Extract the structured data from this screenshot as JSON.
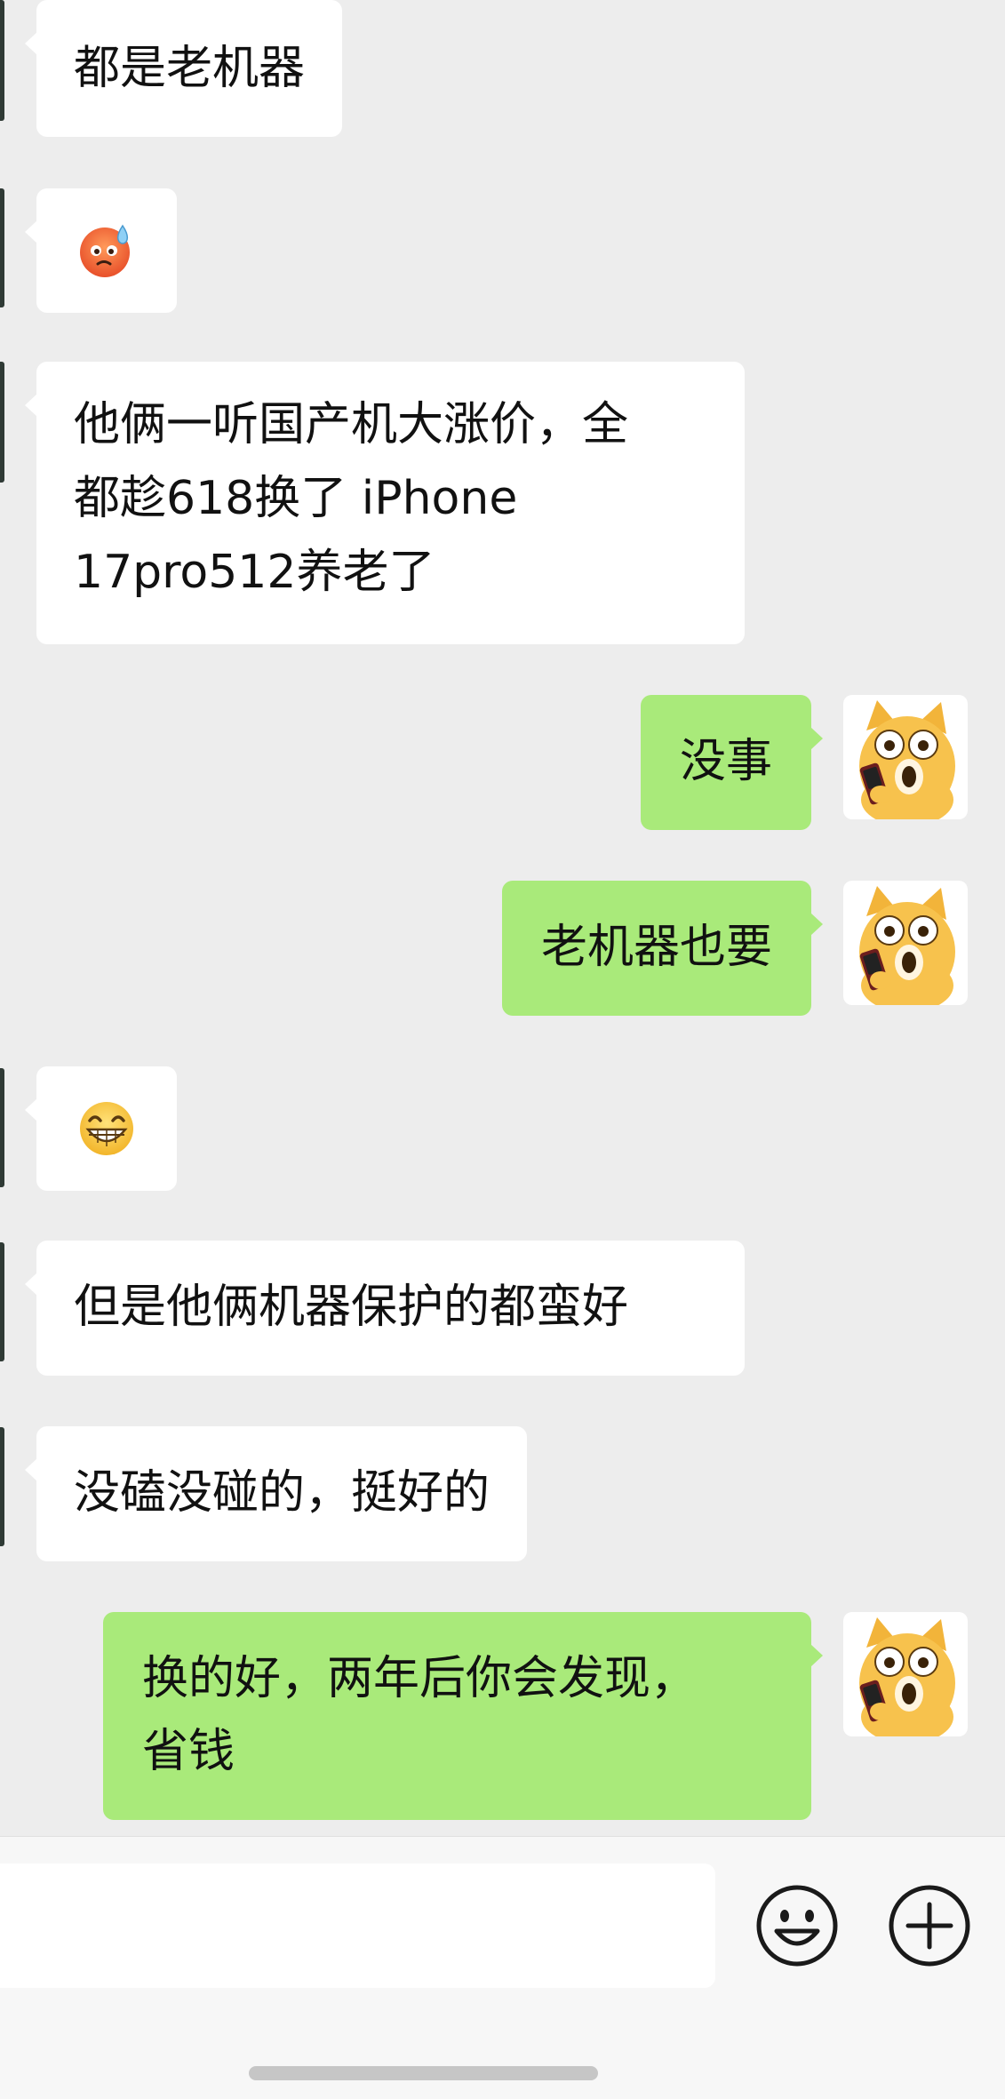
{
  "messages": [
    {
      "side": "in",
      "type": "text",
      "text": "都是老机器"
    },
    {
      "side": "in",
      "type": "emoji",
      "emoji": "sweat-face-emoji"
    },
    {
      "side": "in",
      "type": "text",
      "text": "他俩一听国产机大涨价，全都趁618换了 iPhone 17pro512养老了"
    },
    {
      "side": "out",
      "type": "text",
      "text": "没事"
    },
    {
      "side": "out",
      "type": "text",
      "text": "老机器也要"
    },
    {
      "side": "in",
      "type": "emoji",
      "emoji": "grin-emoji"
    },
    {
      "side": "in",
      "type": "text",
      "text": "但是他俩机器保护的都蛮好"
    },
    {
      "side": "in",
      "type": "text",
      "text": "没磕没碰的，挺好的"
    },
    {
      "side": "out",
      "type": "text",
      "text": "换的好，两年后你会发现，省钱"
    }
  ],
  "chat": {
    "msg1": "都是老机器",
    "msg3": "他俩一听国产机大涨价，全\n都趁618换了 iPhone\n17pro512养老了",
    "msg4": "没事",
    "msg5": "老机器也要",
    "msg7": "但是他俩机器保护的都蛮好",
    "msg8": "没磕没碰的，挺好的",
    "msg9": "换的好，两年后你会发现，\n省钱"
  },
  "icons": {
    "emoji_button": "smiley-face-icon",
    "more_button": "plus-circle-icon",
    "avatar": "doge-shocked-sticker"
  },
  "colors": {
    "background": "#ededed",
    "incoming_bubble": "#ffffff",
    "outgoing_bubble": "#a9ea7a",
    "input_bar": "#f7f7f7"
  }
}
